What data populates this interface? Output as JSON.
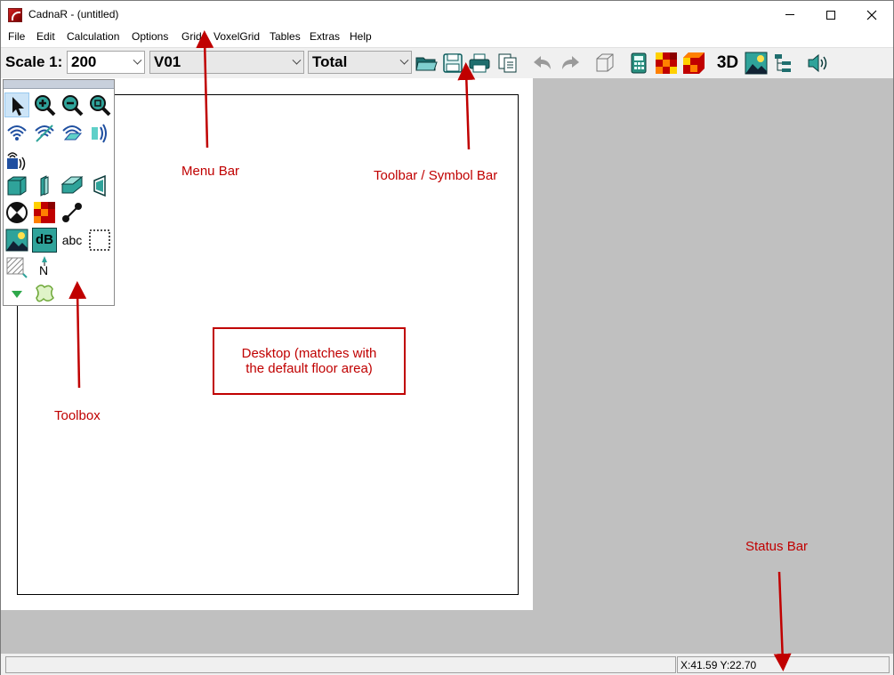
{
  "window": {
    "title": "CadnaR - (untitled)"
  },
  "menu": [
    "File",
    "Edit",
    "Calculation",
    "Options",
    "Grid",
    "VoxelGrid",
    "Tables",
    "Extras",
    "Help"
  ],
  "toolbar": {
    "scale_label": "Scale 1:",
    "scale_value": "200",
    "variant_value": "V01",
    "total_value": "Total",
    "three_d_label": "3D",
    "icons": [
      "open-folder-icon",
      "save-icon",
      "print-icon",
      "copy-document-icon",
      "undo-icon",
      "redo-icon",
      "3d-box-icon",
      "calculator-icon",
      "grid-map-icon",
      "3d-grid-map-icon",
      "3d-view-icon",
      "landscape-image-icon",
      "object-tree-icon",
      "speaker-icon"
    ]
  },
  "toolbox": {
    "abc_label": "abc",
    "db_label": "dB",
    "north_label": "N",
    "tools": [
      "select-arrow-icon",
      "zoom-in-icon",
      "zoom-out-icon",
      "zoom-fit-icon",
      "point-source-icon",
      "line-source-icon",
      "area-source-icon",
      "directional-source-icon",
      "speaker-box-icon",
      "room-volume-icon",
      "barrier-icon",
      "wall-panel-icon",
      "door-icon",
      "receiver-point-icon",
      "grid-area-icon",
      "receiver-line-icon",
      "landscape-icon",
      "db-label-icon",
      "text-label-icon",
      "selection-rectangle-icon",
      "hatched-area-icon",
      "north-arrow-icon",
      "triangle-marker-icon",
      "polygon-icon"
    ]
  },
  "statusbar": {
    "coords": "X:41.59 Y:22.70"
  },
  "annotations": {
    "menu_bar": "Menu Bar",
    "toolbar": "Toolbar / Symbol Bar",
    "toolbox": "Toolbox",
    "desktop_line1": "Desktop (matches with",
    "desktop_line2": "the default floor area)",
    "status_bar": "Status Bar"
  },
  "colors": {
    "annotation": "#c00000",
    "workspace": "#c0c0c0"
  }
}
